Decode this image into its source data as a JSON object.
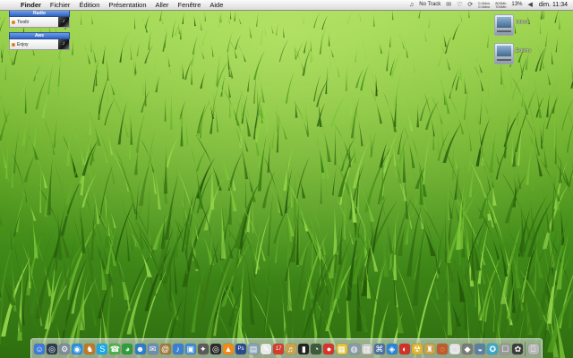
{
  "menubar": {
    "apple_glyph": "",
    "menus": [
      "Finder",
      "Fichier",
      "Édition",
      "Présentation",
      "Aller",
      "Fenêtre",
      "Aide"
    ],
    "status": {
      "itunes_glyph": "♫",
      "track": "No Track",
      "netstat_top": "0.0kb/s",
      "netstat_bottom": "0.0kb/s",
      "mem_top": "800Mb",
      "mem_bottom": "700Mb",
      "cpu": "13%",
      "clock": "dim. 11:34"
    }
  },
  "widget": {
    "sections": [
      {
        "header": "Radio",
        "item": "Tivoltr"
      },
      {
        "header": "Aws",
        "item": "Enjoy"
      }
    ]
  },
  "desktop": {
    "disks": [
      {
        "label": "Interne"
      },
      {
        "label": "Externe"
      }
    ]
  },
  "dock": {
    "items": [
      {
        "name": "finder-icon",
        "glyph": "☺",
        "color": "#3d7bd8"
      },
      {
        "name": "dashboard-icon",
        "glyph": "◎",
        "color": "#2d3b4f"
      },
      {
        "name": "system-preferences-icon",
        "glyph": "⚙",
        "color": "#7d8c9a"
      },
      {
        "name": "safari-icon",
        "glyph": "◉",
        "color": "#2e8fe0"
      },
      {
        "name": "camino-icon",
        "glyph": "♞",
        "color": "#b97a2c"
      },
      {
        "name": "skype-icon",
        "glyph": "S",
        "color": "#1aa8e6"
      },
      {
        "name": "ichat-icon",
        "glyph": "☎",
        "color": "#4db04a"
      },
      {
        "name": "adium-icon",
        "glyph": "◕",
        "color": "#2e9d3a"
      },
      {
        "name": "messenger-icon",
        "glyph": "☻",
        "color": "#2d7cc8"
      },
      {
        "name": "mail-icon",
        "glyph": "✉",
        "color": "#6c8db0"
      },
      {
        "name": "addressbook-icon",
        "glyph": "@",
        "color": "#a07a3c"
      },
      {
        "name": "itunes-icon",
        "glyph": "♪",
        "color": "#3a7fd1"
      },
      {
        "name": "iphoto-icon",
        "glyph": "▣",
        "color": "#3d8ad1"
      },
      {
        "name": "imovie-icon",
        "glyph": "✦",
        "color": "#5a5a5a"
      },
      {
        "name": "dvd-player-icon",
        "glyph": "◎",
        "color": "#2b2b2b"
      },
      {
        "name": "vlc-icon",
        "glyph": "▲",
        "color": "#f08b1a"
      },
      {
        "name": "photoshop-icon",
        "glyph": "Ps",
        "color": "#2b4b8f"
      },
      {
        "name": "preview-icon",
        "glyph": "▤",
        "color": "#86a0b8"
      },
      {
        "name": "textedit-icon",
        "glyph": "✎",
        "color": "#e9e9e9"
      },
      {
        "name": "ical-icon",
        "glyph": "17",
        "color": "#d33c2f"
      },
      {
        "name": "garageband-icon",
        "glyph": "♬",
        "color": "#c9a24a"
      },
      {
        "name": "terminal-icon",
        "glyph": "▮",
        "color": "#222222"
      },
      {
        "name": "activity-monitor-icon",
        "glyph": "◔",
        "color": "#3d5a3d"
      },
      {
        "name": "stop-icon",
        "glyph": "●",
        "color": "#d8342b"
      },
      {
        "name": "stickies-icon",
        "glyph": "▦",
        "color": "#e3c23a"
      },
      {
        "name": "disk-utility-icon",
        "glyph": "◍",
        "color": "#8a9aa8"
      },
      {
        "name": "calendar-icon",
        "glyph": "▥",
        "color": "#c9c9c9"
      },
      {
        "name": "grapher-icon",
        "glyph": "⌘",
        "color": "#4b6fa3"
      },
      {
        "name": "network-icon",
        "glyph": "◈",
        "color": "#2c85d4"
      },
      {
        "name": "transmission-icon",
        "glyph": "◐",
        "color": "#d0322a"
      },
      {
        "name": "uploader-icon",
        "glyph": "☢",
        "color": "#e0b32a"
      },
      {
        "name": "chess-icon",
        "glyph": "♜",
        "color": "#c9a24a"
      },
      {
        "name": "app-a-icon",
        "glyph": "◌",
        "color": "#c25b2a"
      },
      {
        "name": "app-b-icon",
        "glyph": "▢",
        "color": "#e0e0e0"
      },
      {
        "name": "app-c-icon",
        "glyph": "◆",
        "color": "#7a7a7a"
      },
      {
        "name": "app-d-icon",
        "glyph": "◒",
        "color": "#5d7fa1"
      },
      {
        "name": "app-e-icon",
        "glyph": "✪",
        "color": "#3aa6c9"
      },
      {
        "name": "app-f-icon",
        "glyph": "☐",
        "color": "#9a9a9a"
      },
      {
        "name": "app-g-icon",
        "glyph": "✿",
        "color": "#3c3c3c"
      },
      {
        "name": "trash-icon",
        "glyph": "⎕",
        "color": "#b9b9b9"
      }
    ]
  }
}
